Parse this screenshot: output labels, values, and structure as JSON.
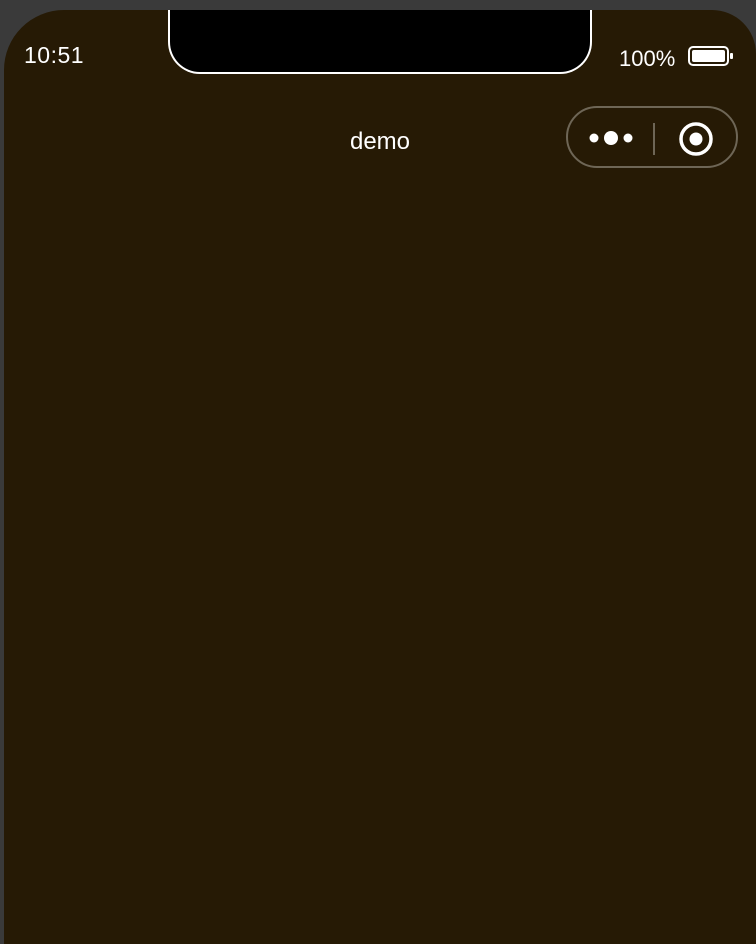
{
  "status_bar": {
    "time": "10:51",
    "battery_percent": "100%",
    "battery_level": 1.0
  },
  "nav_bar": {
    "title": "demo",
    "capsule": {
      "more_icon": "more-dots-icon",
      "close_icon": "target-circle-icon"
    }
  },
  "colors": {
    "page_background": "#261a05",
    "text": "#ffffff",
    "capsule_border": "#6e6656"
  }
}
